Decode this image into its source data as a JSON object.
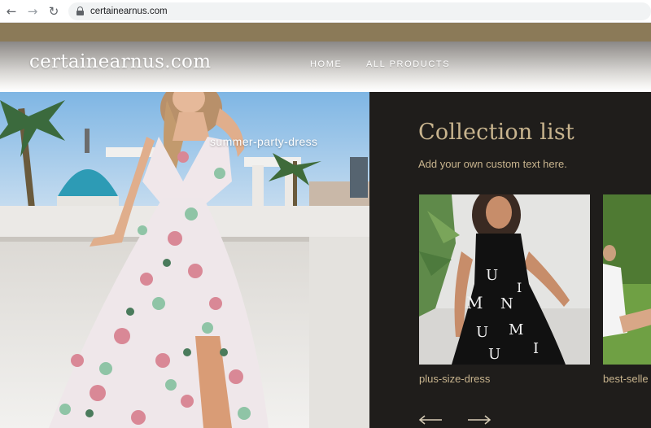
{
  "browser": {
    "url": "certainearnus.com",
    "icons": [
      "back-arrow-icon",
      "forward-arrow-icon",
      "reload-icon",
      "lock-icon"
    ]
  },
  "header": {
    "logo": "certainearnus.com",
    "nav": [
      {
        "label": "HOME"
      },
      {
        "label": "ALL PRODUCTS"
      }
    ]
  },
  "hero": {
    "caption": "summer-party-dress"
  },
  "collection": {
    "title": "Collection list",
    "subtitle": "Add your own custom text here.",
    "items": [
      {
        "label": "plus-size-dress"
      },
      {
        "label": "best-selle"
      }
    ],
    "controls": [
      "previous-arrow-icon",
      "next-arrow-icon"
    ]
  },
  "colors": {
    "announcement": "#8b7a58",
    "panel_bg": "#1f1d1b",
    "accent_text": "#c8b48e"
  }
}
